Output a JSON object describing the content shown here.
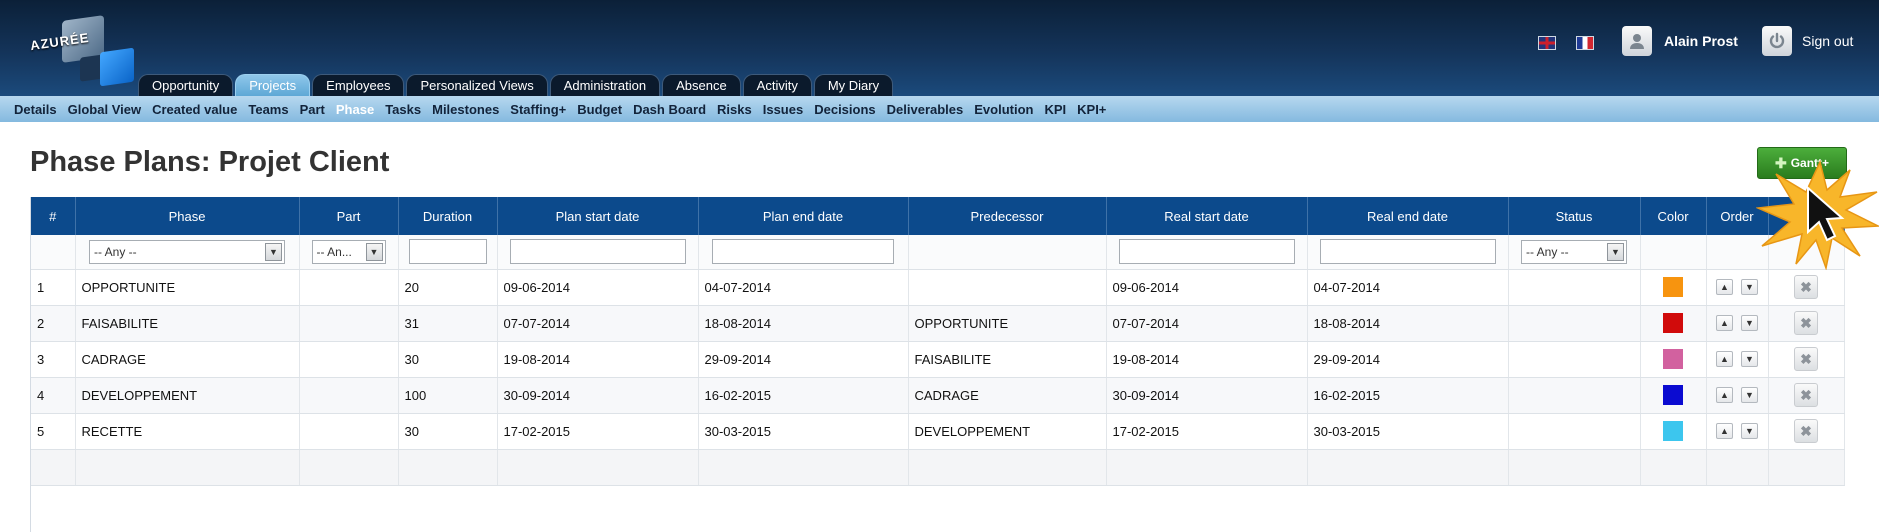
{
  "header": {
    "logo_text": "AZURÉE",
    "user_name": "Alain Prost",
    "signout_label": "Sign out",
    "main_tabs": [
      {
        "label": "Opportunity",
        "active": false
      },
      {
        "label": "Projects",
        "active": true
      },
      {
        "label": "Employees",
        "active": false
      },
      {
        "label": "Personalized Views",
        "active": false
      },
      {
        "label": "Administration",
        "active": false
      },
      {
        "label": "Absence",
        "active": false
      },
      {
        "label": "Activity",
        "active": false
      },
      {
        "label": "My Diary",
        "active": false
      }
    ]
  },
  "subnav": {
    "items": [
      {
        "label": "Details",
        "active": false
      },
      {
        "label": "Global View",
        "active": false
      },
      {
        "label": "Created value",
        "active": false
      },
      {
        "label": "Teams",
        "active": false
      },
      {
        "label": "Part",
        "active": false
      },
      {
        "label": "Phase",
        "active": true
      },
      {
        "label": "Tasks",
        "active": false
      },
      {
        "label": "Milestones",
        "active": false
      },
      {
        "label": "Staffing+",
        "active": false
      },
      {
        "label": "Budget",
        "active": false
      },
      {
        "label": "Dash Board",
        "active": false
      },
      {
        "label": "Risks",
        "active": false
      },
      {
        "label": "Issues",
        "active": false
      },
      {
        "label": "Decisions",
        "active": false
      },
      {
        "label": "Deliverables",
        "active": false
      },
      {
        "label": "Evolution",
        "active": false
      },
      {
        "label": "KPI",
        "active": false
      },
      {
        "label": "KPI+",
        "active": false
      }
    ]
  },
  "page": {
    "title": "Phase Plans: Projet Client",
    "gantt_label": "Gantt+"
  },
  "table": {
    "columns": [
      "#",
      "Phase",
      "Part",
      "Duration",
      "Plan start date",
      "Plan end date",
      "Predecessor",
      "Real start date",
      "Real end date",
      "Status",
      "Color",
      "Order",
      ""
    ],
    "filters": {
      "phase": "-- Any --",
      "part": "-- An...",
      "status": "-- Any --"
    },
    "rows": [
      {
        "num": "1",
        "phase": "OPPORTUNITE",
        "part": "",
        "duration": "20",
        "plan_start": "09-06-2014",
        "plan_end": "04-07-2014",
        "predecessor": "",
        "real_start": "09-06-2014",
        "real_end": "04-07-2014",
        "status": "",
        "color": "#f7940f"
      },
      {
        "num": "2",
        "phase": "FAISABILITE",
        "part": "",
        "duration": "31",
        "plan_start": "07-07-2014",
        "plan_end": "18-08-2014",
        "predecessor": "OPPORTUNITE",
        "real_start": "07-07-2014",
        "real_end": "18-08-2014",
        "status": "",
        "color": "#d10b0b"
      },
      {
        "num": "3",
        "phase": "CADRAGE",
        "part": "",
        "duration": "30",
        "plan_start": "19-08-2014",
        "plan_end": "29-09-2014",
        "predecessor": "FAISABILITE",
        "real_start": "19-08-2014",
        "real_end": "29-09-2014",
        "status": "",
        "color": "#d2619f"
      },
      {
        "num": "4",
        "phase": "DEVELOPPEMENT",
        "part": "",
        "duration": "100",
        "plan_start": "30-09-2014",
        "plan_end": "16-02-2015",
        "predecessor": "CADRAGE",
        "real_start": "30-09-2014",
        "real_end": "16-02-2015",
        "status": "",
        "color": "#0b0bd1"
      },
      {
        "num": "5",
        "phase": "RECETTE",
        "part": "",
        "duration": "30",
        "plan_start": "17-02-2015",
        "plan_end": "30-03-2015",
        "predecessor": "DEVELOPPEMENT",
        "real_start": "17-02-2015",
        "real_end": "30-03-2015",
        "status": "",
        "color": "#3cc6ee"
      }
    ]
  },
  "icons": {
    "user": "user-avatar-icon",
    "signout": "power-icon",
    "move_up": "arrow-up-icon",
    "move_down": "arrow-down-icon",
    "delete": "close-icon",
    "gantt": "plus-icon",
    "pointer": "mouse-cursor-icon"
  }
}
